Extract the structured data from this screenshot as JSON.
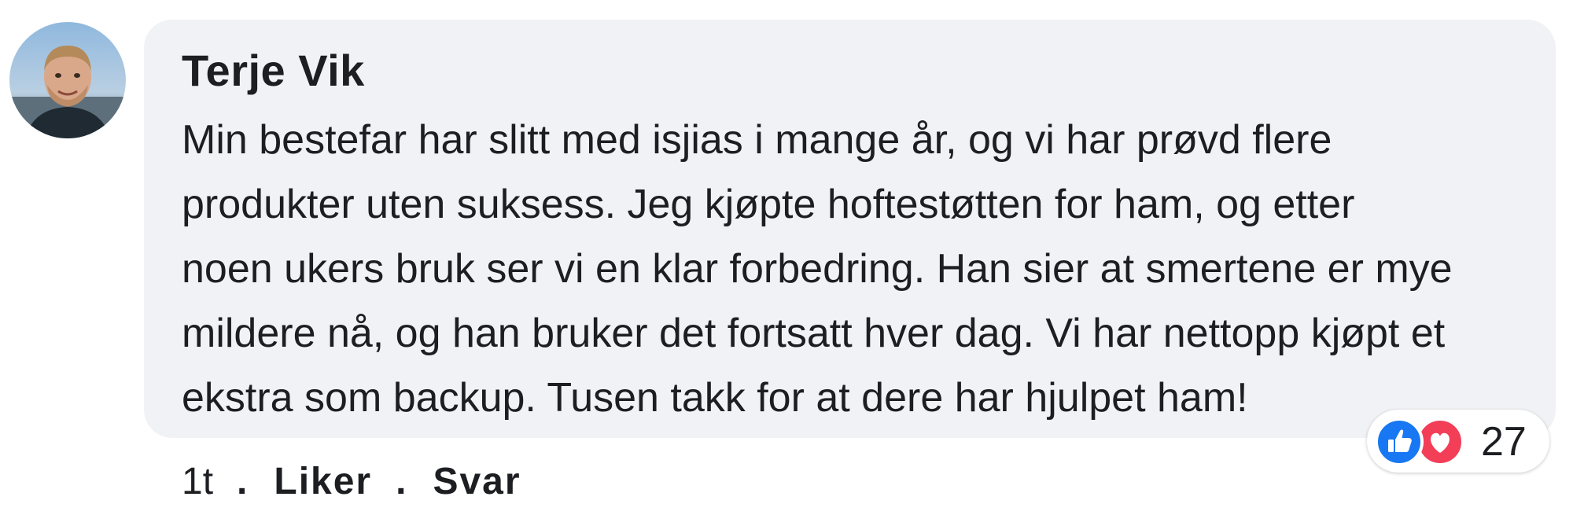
{
  "comment": {
    "author": "Terje Vik",
    "text_lines": [
      "Min bestefar har slitt med isjias i mange år, og vi har prøvd flere",
      "produkter uten suksess. Jeg kjøpte hoftestøtten for ham, og etter",
      "noen ukers bruk ser vi en klar forbedring. Han sier at smertene er mye",
      "mildere nå, og han bruker det fortsatt hver dag. Vi har nettopp kjøpt et",
      "ekstra som backup. Tusen takk for at dere har hjulpet ham!"
    ],
    "reactions": {
      "icons": [
        "like-icon",
        "love-icon"
      ],
      "count": "27",
      "colors": {
        "like": "#1877f2",
        "love": "#f33e58"
      }
    },
    "actions": {
      "time": "1t",
      "separator": ".",
      "like_label": "Liker",
      "reply_label": "Svar"
    }
  },
  "colors": {
    "bubble": "#f0f2f5",
    "text": "#1c1e21"
  }
}
